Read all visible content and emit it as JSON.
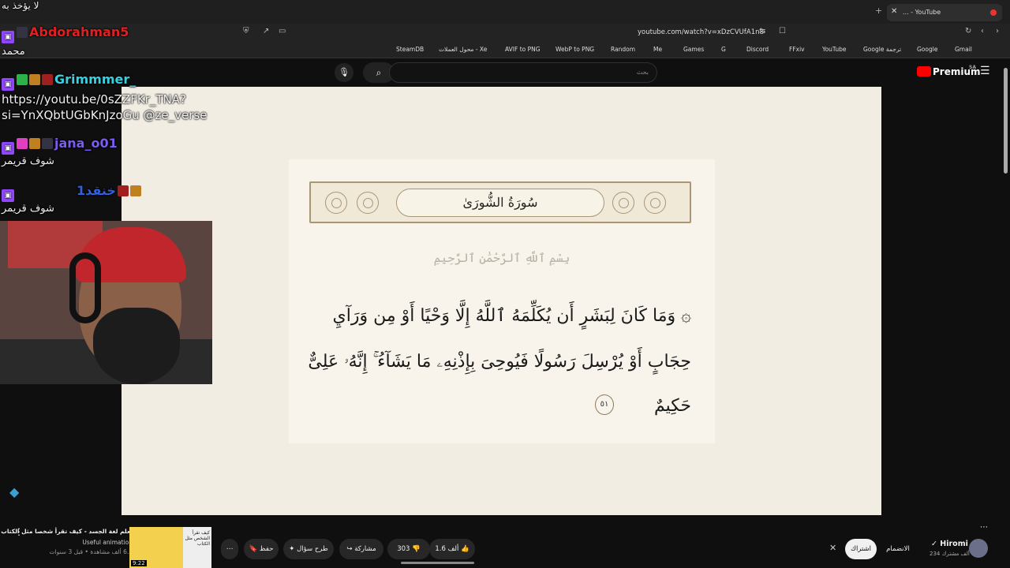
{
  "browser": {
    "tab_title": "... - YouTube",
    "url": "youtube.com/watch?v=xDzCVUfA1n8",
    "bookmarks": [
      "Gmail",
      "Google",
      "Google ترجمة",
      "YouTube",
      "FFxiv",
      "Discord",
      "G",
      "Games",
      "Me",
      "Random",
      "WebP to PNG",
      "AVIF to PNG",
      "محول العملات - Xe",
      "SteamDB"
    ]
  },
  "youtube": {
    "search_placeholder": "بحث",
    "premium_label": "Premium",
    "region": "SA"
  },
  "mushaf": {
    "surah_title": "سُورَةُ الشُّورَىٰ",
    "basmala": "بِسْمِ ٱللَّهِ ٱلرَّحْمَٰنِ ٱلرَّحِيمِ",
    "line1": "۞ وَمَا كَانَ لِبَشَرٍ أَن يُكَلِّمَهُ ٱللَّهُ إِلَّا وَحْيًا أَوْ مِن وَرَآيِ",
    "line2": "حِجَابٍ أَوْ يُرْسِلَ رَسُولًا فَيُوحِىَ بِإِذْنِهِۦ مَا يَشَآءُ ۚ إِنَّهُۥ عَلِىٌّ",
    "line3": "حَكِيمٌ",
    "ayah_number": "٥١"
  },
  "chat": {
    "top_text": "لا يؤخذ به",
    "messages": [
      {
        "user": "Abdorahman5",
        "user_color": "#e02020",
        "text": "محمد"
      },
      {
        "user": "Grimmmer_",
        "user_color": "#3ad0e0",
        "text": "https://youtu.be/0sZZFKr_TNA?si=YnXQbtUGbKnJzoGu @ze_verse"
      },
      {
        "user": "jana_o01",
        "user_color": "#7b5cf0",
        "text": "شوف قريمر"
      },
      {
        "user": "1خنقد",
        "user_color": "#3060e0",
        "text": "شوف قريمر"
      }
    ],
    "message_text_line1": "https://youtu.be/0sZZFKr_TNA?",
    "message_text_line2": "si=YnXQbtUGbKnJzoGu @ze_verse"
  },
  "video_bar": {
    "channel_name": "Hiromi",
    "subscribers": "234 ألف مشترك",
    "join_label": "الانضمام",
    "subscribe_label": "اشتراك",
    "like_count": "1.6 ألف",
    "dislike_count": "303",
    "share_label": "مشاركة",
    "ask_label": "طرح سؤال",
    "save_label": "حفظ",
    "rec_title": "تعلم لغة الجسد - كيف تقرأ شخصا مثل الكتاب",
    "rec_channel": "Useful animation",
    "rec_meta": "6.5 ألف مشاهدة • قبل 3 سنوات",
    "rec_duration": "9:22",
    "rec_thumb_text": "كيف تقرأ الشخص مثل الكتاب"
  }
}
